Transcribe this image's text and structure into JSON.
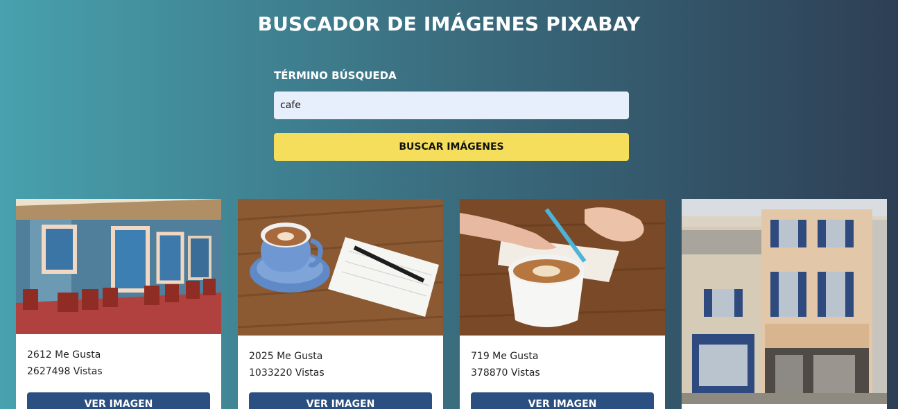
{
  "header": {
    "title": "BUSCADOR DE IMÁGENES PIXABAY"
  },
  "search": {
    "label": "TÉRMINO BÚSQUEDA",
    "value": "cafe",
    "button_label": "BUSCAR IMÁGENES"
  },
  "results": [
    {
      "likes": "2612 Me Gusta",
      "views": "2627498 Vistas",
      "button_label": "VER IMAGEN",
      "image": "street-cafe-facade-image"
    },
    {
      "likes": "2025 Me Gusta",
      "views": "1033220 Vistas",
      "button_label": "VER IMAGEN",
      "image": "coffee-cup-notebook-image"
    },
    {
      "likes": "719 Me Gusta",
      "views": "378870 Vistas",
      "button_label": "VER IMAGEN",
      "image": "latte-writing-image"
    },
    {
      "image": "hotel-restaurant-facade-image"
    }
  ],
  "colors": {
    "accent_yellow": "#f5de5b",
    "button_blue": "#2a4f80",
    "input_bg": "#e8effc"
  }
}
